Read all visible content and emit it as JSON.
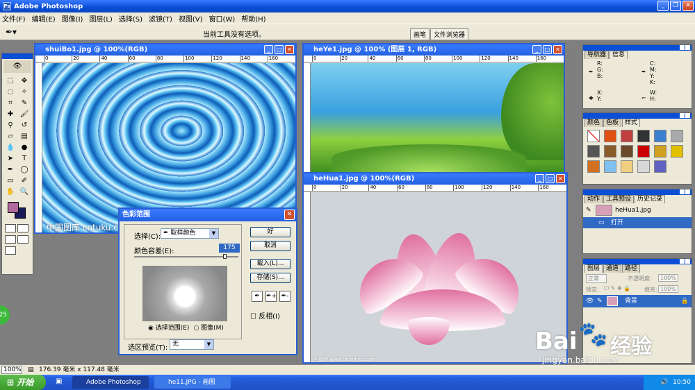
{
  "app": {
    "title": "Adobe Photoshop"
  },
  "menu": [
    "文件(F)",
    "编辑(E)",
    "图像(I)",
    "图层(L)",
    "选择(S)",
    "滤镜(T)",
    "视图(V)",
    "窗口(W)",
    "帮助(H)"
  ],
  "options": {
    "hint": "当前工具没有选项。",
    "well_tabs": [
      "画笔",
      "文件浏览器"
    ]
  },
  "docs": {
    "shuibo": {
      "title": "shuiBo1.jpg @ 100%(RGB)",
      "watermark": "中国图库 cntuku.cn"
    },
    "heye": {
      "title": "heYe1.jpg @ 100% (图层 1, RGB)"
    },
    "hehua": {
      "title": "heHua1.jpg @ 100%(RGB)",
      "credit": "全景网 www.quanjing.com",
      "code": "214-8054"
    },
    "ruler": [
      "0",
      "20",
      "40",
      "60",
      "80",
      "100",
      "120",
      "140",
      "160"
    ]
  },
  "dialog": {
    "title": "色彩范围",
    "select_label": "选择(C):",
    "select_value": "取样颜色",
    "fuzz_label": "颜色容差(E):",
    "fuzz_value": "175",
    "fuzziness": 175,
    "radio_selection": "选择范围(E)",
    "radio_image": "图像(M)",
    "preview_label": "选区预览(T):",
    "preview_value": "无",
    "ok": "好",
    "cancel": "取消",
    "load": "载入(L)...",
    "save": "存储(S)...",
    "invert": "反相(I)"
  },
  "panels": {
    "nav": {
      "tabs": [
        "导航器",
        "信息"
      ],
      "labels": {
        "rgb": "R: G: B:",
        "cmyk": "C: M: Y: K:",
        "xy": "X: Y:",
        "wh": "W: H:"
      }
    },
    "color": {
      "tabs": [
        "颜色",
        "色板",
        "样式"
      ]
    },
    "history": {
      "tabs": [
        "动作",
        "工具预设",
        "历史记录"
      ],
      "doc": "heHua1.jpg",
      "state": "打开"
    },
    "layers": {
      "tabs": [
        "图层",
        "通道",
        "路径"
      ],
      "mode": "正常",
      "opacity_label": "不透明度:",
      "opacity": "100%",
      "lock_label": "锁定:",
      "fill_label": "填充:",
      "fill": "100%",
      "layer_name": "背景"
    }
  },
  "status": {
    "zoom": "100%",
    "dims": "176.39 毫米 x 117.48 毫米"
  },
  "taskbar": {
    "start": "开始",
    "tasks": [
      "Adobe Photoshop",
      "he11.JPG - 画图"
    ],
    "time": "10:50"
  },
  "watermark": {
    "brand": "Bai",
    "brand_cn": "经验",
    "url": "jingyan.baidu.com"
  },
  "colors": {
    "foreground": "#b06aa0",
    "background": "#1a1a5a",
    "title_blue": "#2260e0",
    "selection": "#316ac5"
  }
}
